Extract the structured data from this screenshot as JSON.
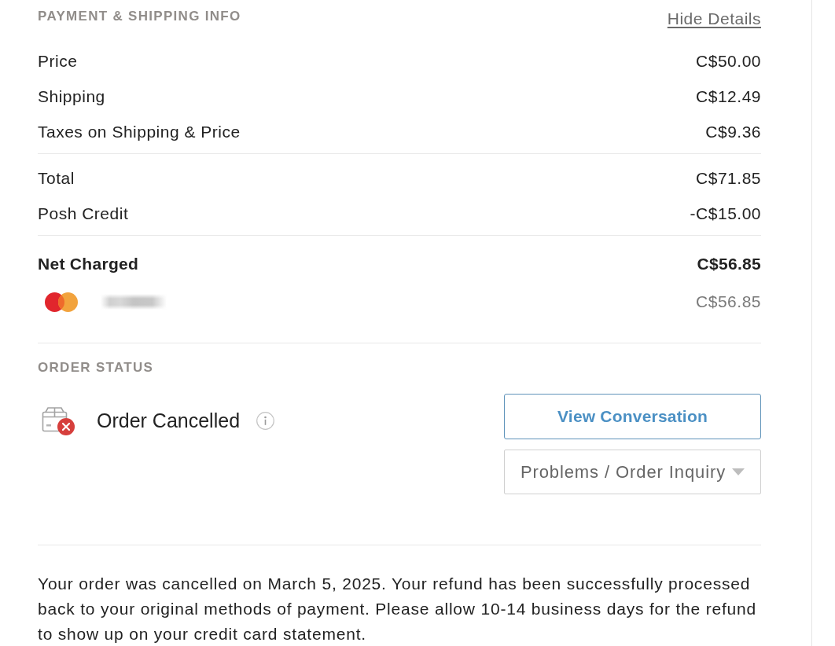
{
  "payment_section": {
    "heading": "PAYMENT & SHIPPING INFO",
    "toggle_link": "Hide Details",
    "groups": [
      {
        "lines": [
          {
            "kind": "item",
            "label": "Price",
            "amount": "C$50.00"
          },
          {
            "kind": "item",
            "label": "Shipping",
            "amount": "C$12.49"
          },
          {
            "kind": "item",
            "label": "Taxes on Shipping & Price",
            "amount": "C$9.36"
          }
        ]
      },
      {
        "lines": [
          {
            "kind": "item",
            "label": "Total",
            "amount": "C$71.85"
          },
          {
            "kind": "item",
            "label": "Posh Credit",
            "amount": "-C$15.00"
          }
        ]
      },
      {
        "lines": [
          {
            "kind": "net",
            "label": "Net Charged",
            "amount": "C$56.85"
          },
          {
            "kind": "card",
            "amount": "C$56.85"
          }
        ]
      }
    ]
  },
  "order_status": {
    "heading": "ORDER STATUS",
    "status": "Order Cancelled",
    "actions": [
      {
        "kind": "button",
        "label": "View Conversation"
      },
      {
        "kind": "dropdown",
        "label": "Problems / Order Inquiry"
      }
    ]
  },
  "message": "Your order was cancelled on March 5, 2025. Your refund has been successfully processed back to your original methods of payment. Please allow 10-14 business days for the refund to show up on your credit card statement."
}
